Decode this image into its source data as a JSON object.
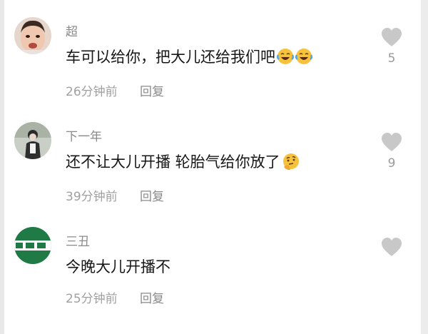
{
  "comments": [
    {
      "user": "超",
      "text": "车可以给你，把大儿还给我们吧",
      "emojis": [
        "laughing-crying-emoji",
        "laughing-crying-emoji"
      ],
      "time": "26分钟前",
      "reply_label": "回复",
      "likes": "5"
    },
    {
      "user": "下一年",
      "text": "还不让大儿开播 轮胎气给你放了",
      "emojis": [
        "thinking-face-emoji"
      ],
      "time": "39分钟前",
      "reply_label": "回复",
      "likes": "9"
    },
    {
      "user": "三丑",
      "text": "今晚大儿开播不",
      "emojis": [],
      "time": "25分钟前",
      "reply_label": "回复",
      "likes": ""
    }
  ],
  "colors": {
    "heart": "#c8c8c8",
    "username": "#8a8a8a",
    "text": "#161616",
    "meta": "#a0a0a0",
    "avatar3_sign": "#1f7a45"
  }
}
